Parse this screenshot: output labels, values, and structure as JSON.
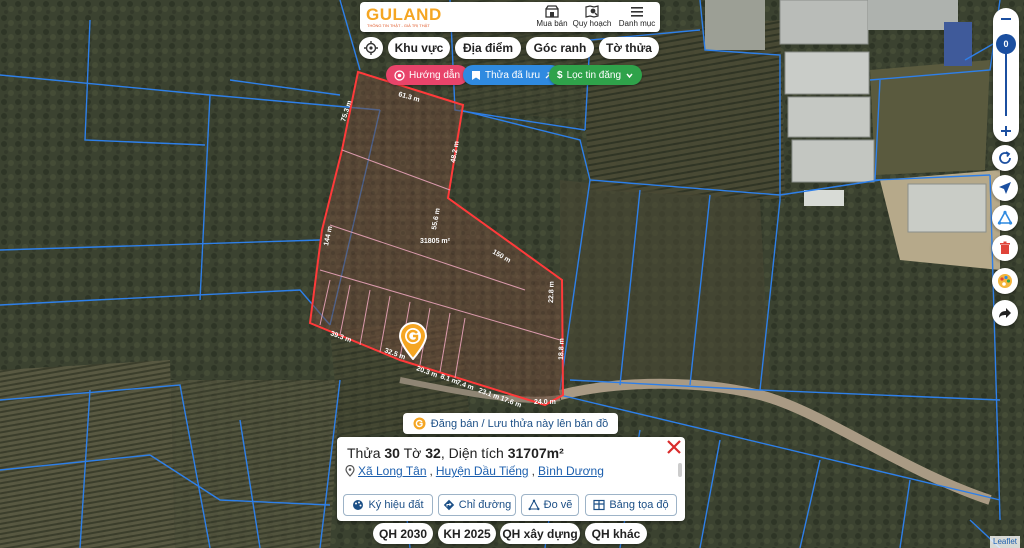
{
  "header": {
    "logo_text": "GULAND",
    "logo_tagline": "THÔNG TIN THẬT - GIÁ TRỊ THẬT",
    "nav": [
      {
        "label": "Mua bán",
        "icon": "shop-icon"
      },
      {
        "label": "Quy hoạch",
        "icon": "map-search-icon"
      },
      {
        "label": "Danh mục",
        "icon": "menu-icon"
      }
    ]
  },
  "search_tabs": [
    "Khu vực",
    "Địa điểm",
    "Góc ranh",
    "Tờ thửa"
  ],
  "chips": {
    "guide": "Hướng dẫn",
    "saved": "Thửa đã lưu",
    "filter": "Lọc tin đăng"
  },
  "colors": {
    "accent": "#f5a623",
    "guide_chip": "#e8446a",
    "saved_chip": "#2f8ae0",
    "filter_chip": "#2fa24a",
    "parcel_outline": "#ff3a3a",
    "boundary_lines": "#2e7fe8",
    "link_blue": "#1c5fae",
    "close_red": "#d92b2b"
  },
  "zoom": {
    "level": "0"
  },
  "parcel": {
    "area_label": "31805 m²",
    "edge_labels": [
      "61.3 m",
      "75.3 m",
      "48.2 m",
      "55.6 m",
      "144 m",
      "150 m",
      "22.8 m",
      "18.8 m",
      "39.3 m",
      "32.5 m",
      "20.3 m",
      "8.1 m",
      "7.4 m",
      "23.1 m",
      "17.6 m",
      "24.0 m",
      "18.8 m"
    ]
  },
  "post_banner": "Đăng bán / Lưu thửa này lên bản đồ",
  "info_card": {
    "prefix": "Thửa ",
    "parcel_no": "30",
    "sheet_word": " Tờ ",
    "sheet_no": "32",
    "area_word": ", Diện tích ",
    "area_value": "31707m²",
    "commune": "Xã Long Tân",
    "district": "Huyện Dầu Tiếng",
    "province": "Bình Dương",
    "actions": [
      "Ký hiệu đất",
      "Chỉ đường",
      "Đo vẽ",
      "Bảng tọa độ"
    ]
  },
  "plan_tabs": [
    "QH 2030",
    "KH 2025",
    "QH xây dựng",
    "QH khác"
  ],
  "attribution": "Leaflet"
}
